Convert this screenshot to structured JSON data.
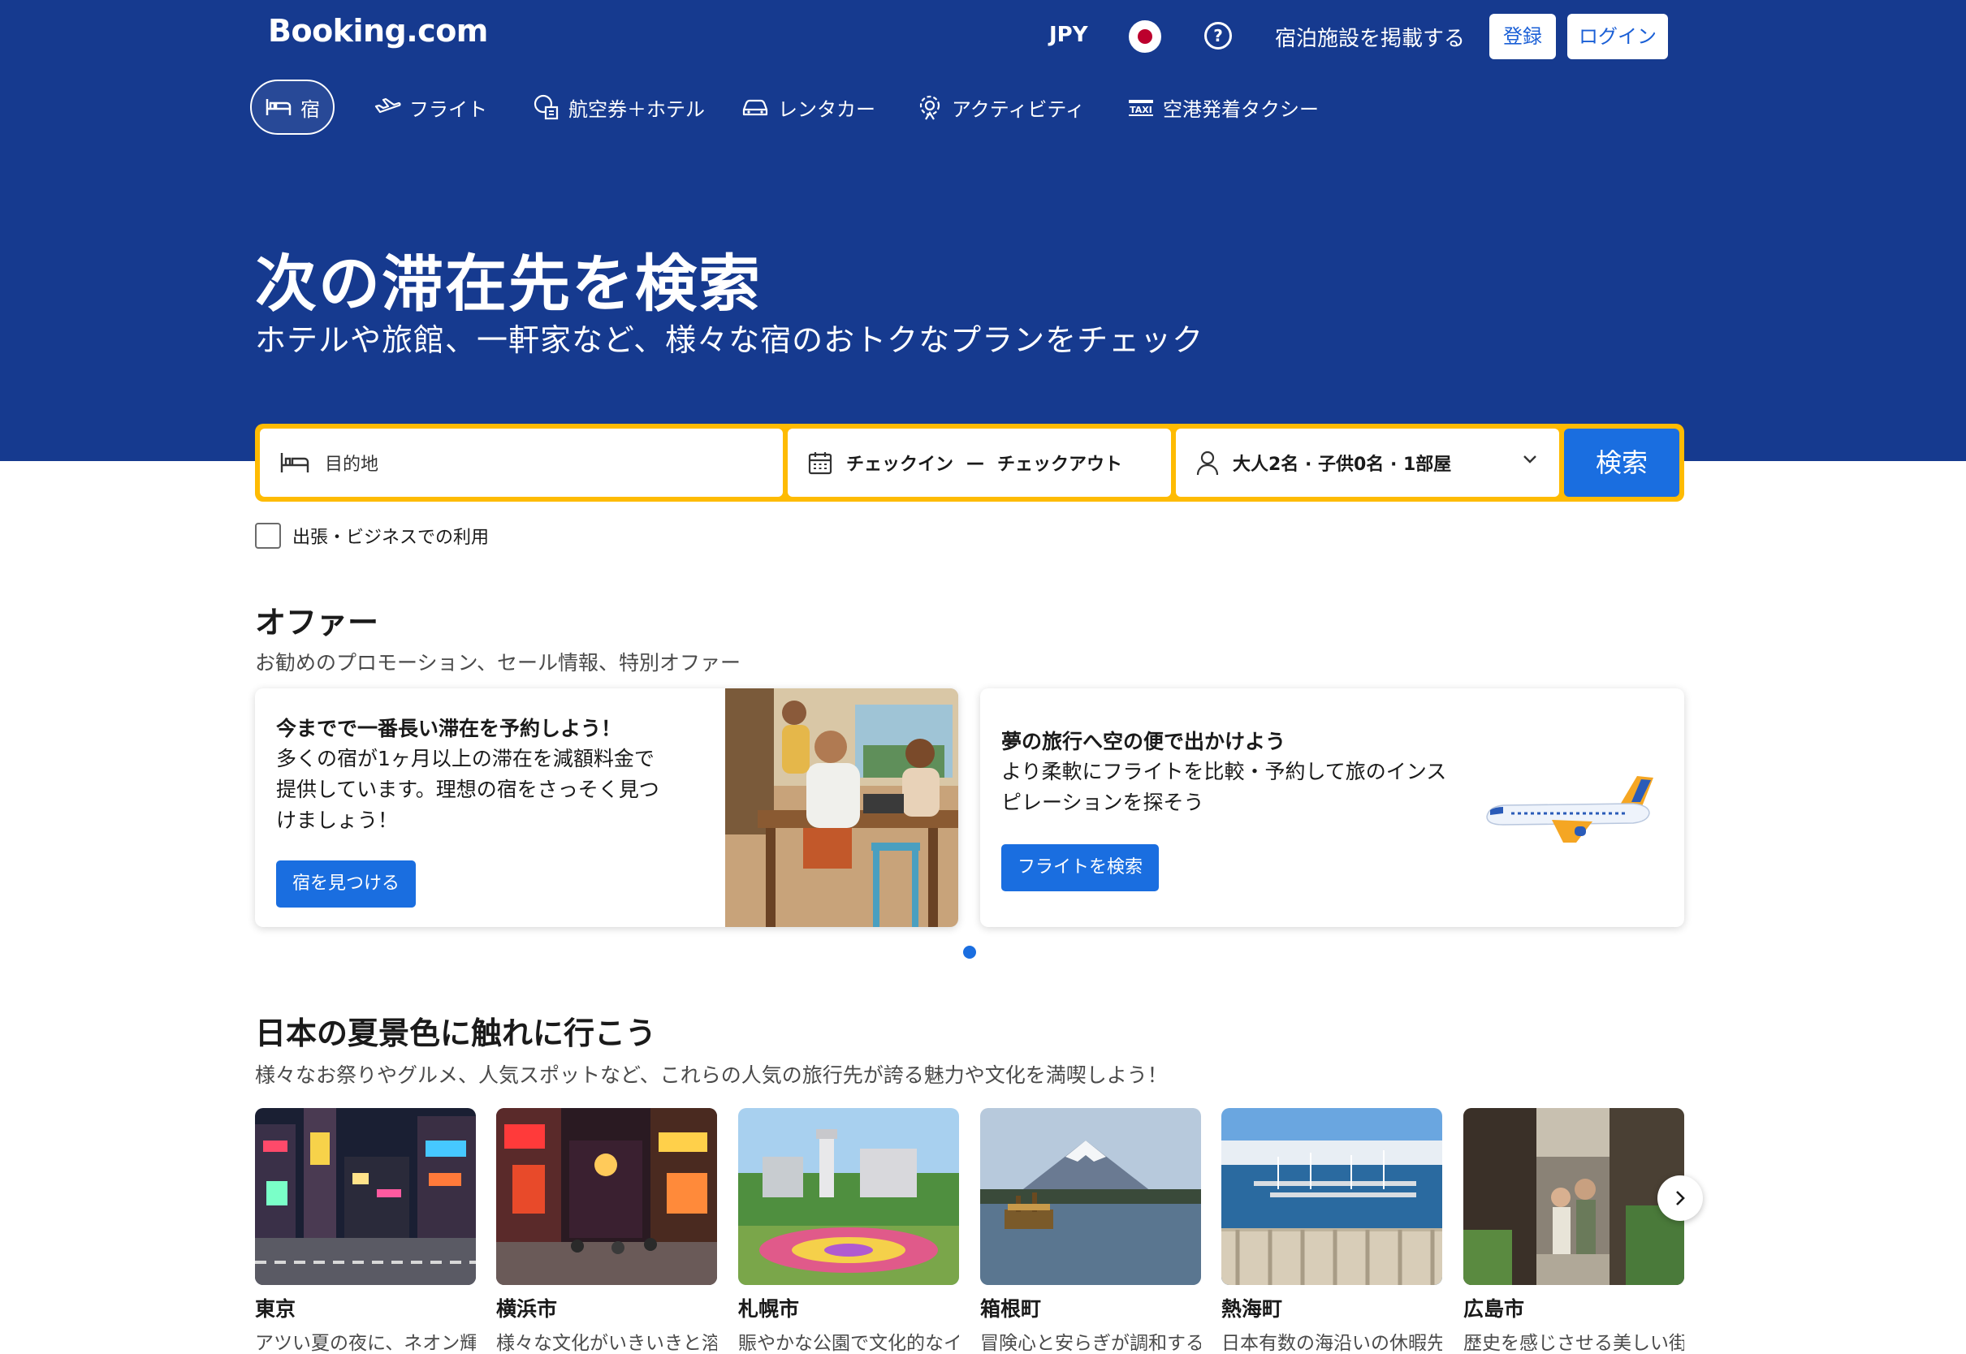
{
  "header": {
    "logo": "Booking.com",
    "currency": "JPY",
    "list_property": "宿泊施設を掲載する",
    "register": "登録",
    "login": "ログイン",
    "help_glyph": "?"
  },
  "nav": [
    {
      "label": "宿",
      "icon": "bed-icon",
      "active": true
    },
    {
      "label": "フライト",
      "icon": "airplane-icon"
    },
    {
      "label": "航空券＋ホテル",
      "icon": "flight-hotel-icon"
    },
    {
      "label": "レンタカー",
      "icon": "car-icon"
    },
    {
      "label": "アクティビティ",
      "icon": "attractions-icon"
    },
    {
      "label": "空港発着タクシー",
      "icon": "taxi-icon"
    }
  ],
  "hero": {
    "title": "次の滞在先を検索",
    "subtitle": "ホテルや旅館、一軒家など、様々な宿のおトクなプランをチェック"
  },
  "search": {
    "destination_placeholder": "目的地",
    "checkin": "チェックイン",
    "dash": "—",
    "checkout": "チェックアウト",
    "guests": "大人2名 · 子供0名 · 1部屋",
    "button": "検索",
    "business_label": "出張・ビジネスでの利用"
  },
  "offers": {
    "title": "オファー",
    "subtitle": "お勧めのプロモーション、セール情報、特別オファー",
    "cards": [
      {
        "title": "今までで一番長い滞在を予約しよう！",
        "body": "多くの宿が1ヶ月以上の滞在を減額料金で提供しています。理想の宿をさっそく見つけましょう！",
        "button": "宿を見つける"
      },
      {
        "title": "夢の旅行へ空の便で出かけよう",
        "body": "より柔軟にフライトを比較・予約して旅のインスピレーションを探そう",
        "button": "フライトを検索"
      }
    ]
  },
  "destinations": {
    "title": "日本の夏景色に触れに行こう",
    "subtitle": "様々なお祭りやグルメ、人気スポットなど、これらの人気の旅行先が誇る魅力や文化を満喫しよう！",
    "items": [
      {
        "name": "東京",
        "desc": "アツい夏の夜に、ネオン輝"
      },
      {
        "name": "横浜市",
        "desc": "様々な文化がいきいきと溶"
      },
      {
        "name": "札幌市",
        "desc": "賑やかな公園で文化的なイ"
      },
      {
        "name": "箱根町",
        "desc": "冒険心と安らぎが調和する"
      },
      {
        "name": "熱海町",
        "desc": "日本有数の海沿いの休暇先"
      },
      {
        "name": "広島市",
        "desc": "歴史を感じさせる美しい街"
      }
    ]
  },
  "colors": {
    "brand_blue": "#163a8f",
    "action_blue": "#1a6ee0",
    "search_yellow": "#febb02"
  }
}
